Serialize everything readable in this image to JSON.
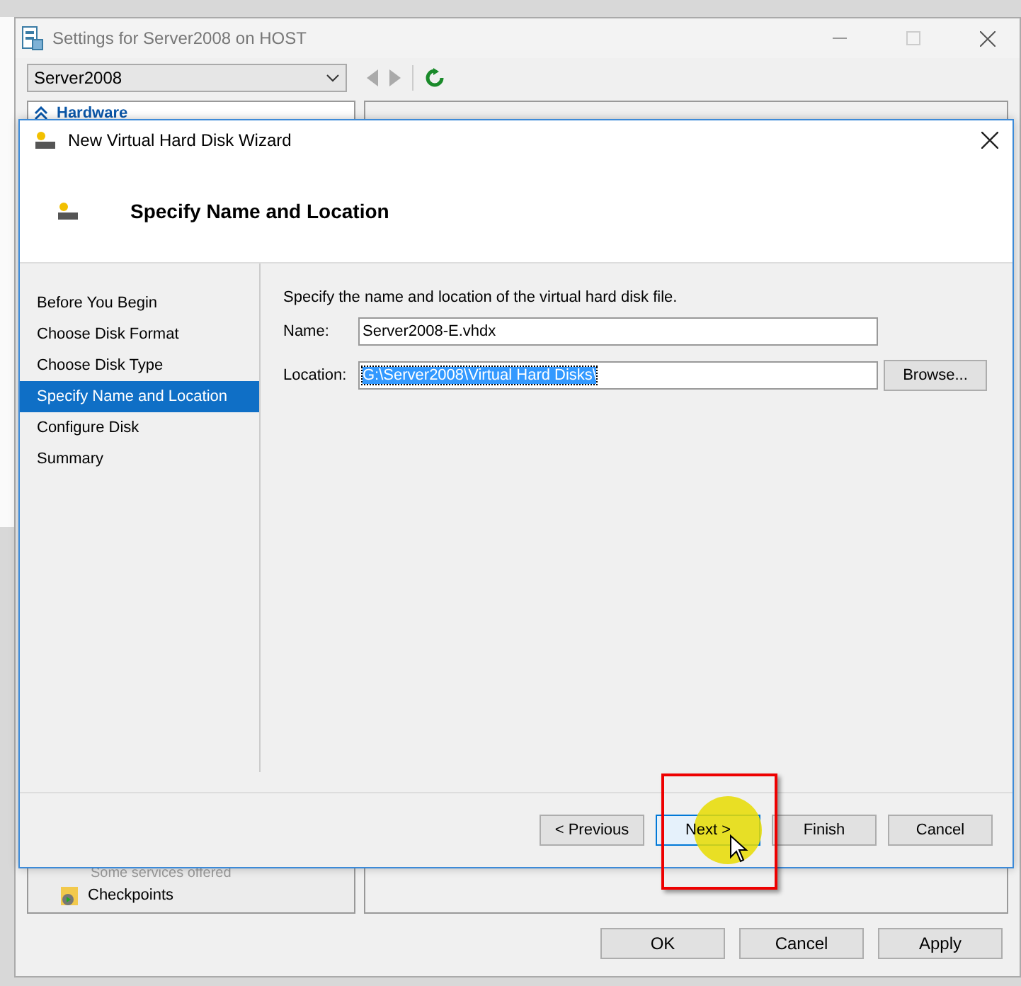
{
  "settings_window": {
    "title": "Settings for Server2008 on HOST",
    "vm_selector": {
      "value": "Server2008"
    },
    "hardware_header": "Hardware",
    "list_items": [
      {
        "text": "Some services offered",
        "kind": "note"
      },
      {
        "text": "Checkpoints",
        "kind": "item"
      }
    ],
    "buttons": [
      {
        "label": "OK"
      },
      {
        "label": "Cancel"
      },
      {
        "label": "Apply"
      }
    ]
  },
  "wizard": {
    "title": "New Virtual Hard Disk Wizard",
    "heading": "Specify Name and Location",
    "steps": [
      {
        "label": "Before You Begin",
        "selected": false
      },
      {
        "label": "Choose Disk Format",
        "selected": false
      },
      {
        "label": "Choose Disk Type",
        "selected": false
      },
      {
        "label": "Specify Name and Location",
        "selected": true
      },
      {
        "label": "Configure Disk",
        "selected": false
      },
      {
        "label": "Summary",
        "selected": false
      }
    ],
    "instruction": "Specify the name and location of the virtual hard disk file.",
    "fields": [
      {
        "label": "Name:",
        "value": "Server2008-E.vhdx",
        "text_selected": false
      },
      {
        "label": "Location:",
        "value": "G:\\Server2008\\Virtual Hard Disks\\",
        "text_selected": true,
        "button": "Browse..."
      }
    ],
    "buttons": [
      {
        "label": "< Previous",
        "focused": false,
        "highlighted": false
      },
      {
        "label": "Next >",
        "focused": true,
        "highlighted": true
      },
      {
        "label": "Finish",
        "focused": false,
        "highlighted": false
      },
      {
        "label": "Cancel",
        "focused": false,
        "highlighted": false
      }
    ]
  }
}
